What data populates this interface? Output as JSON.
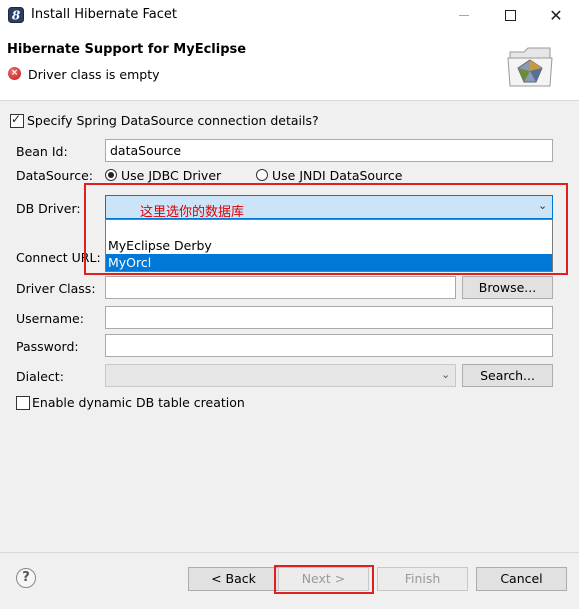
{
  "window": {
    "title": "Install Hibernate Facet",
    "icon": "myeclipse-logo-icon"
  },
  "header": {
    "title": "Hibernate Support for MyEclipse",
    "error_message": "Driver class is empty",
    "error_icon": "error-icon",
    "banner_icon": "wizard-folder-icon"
  },
  "form": {
    "spring_checkbox_label": "Specify Spring DataSource connection details?",
    "spring_checked": true,
    "bean_id_label": "Bean Id:",
    "bean_id_value": "dataSource",
    "datasource_label": "DataSource:",
    "jdbc_label": "Use JDBC Driver",
    "jndi_label": "Use JNDI DataSource",
    "datasource_selected": "Use JDBC Driver",
    "db_driver_label": "DB Driver:",
    "db_driver_value": "这里选你的数据库",
    "db_driver_options": [
      "MyEclipse Derby",
      "MyOrcl"
    ],
    "db_driver_highlighted": "MyOrcl",
    "connect_url_label": "Connect URL:",
    "driver_class_label": "Driver Class:",
    "driver_class_value": "",
    "browse_label": "Browse...",
    "username_label": "Username:",
    "username_value": "",
    "password_label": "Password:",
    "password_value": "",
    "dialect_label": "Dialect:",
    "dialect_value": "",
    "search_label": "Search...",
    "dynamic_checkbox_label": "Enable dynamic DB table creation",
    "dynamic_checked": false
  },
  "footer": {
    "back_label": "< Back",
    "next_label": "Next >",
    "finish_label": "Finish",
    "cancel_label": "Cancel"
  },
  "colors": {
    "annotation": "#e02020",
    "selection": "#0078d7",
    "annotation_text": "#e00000"
  }
}
